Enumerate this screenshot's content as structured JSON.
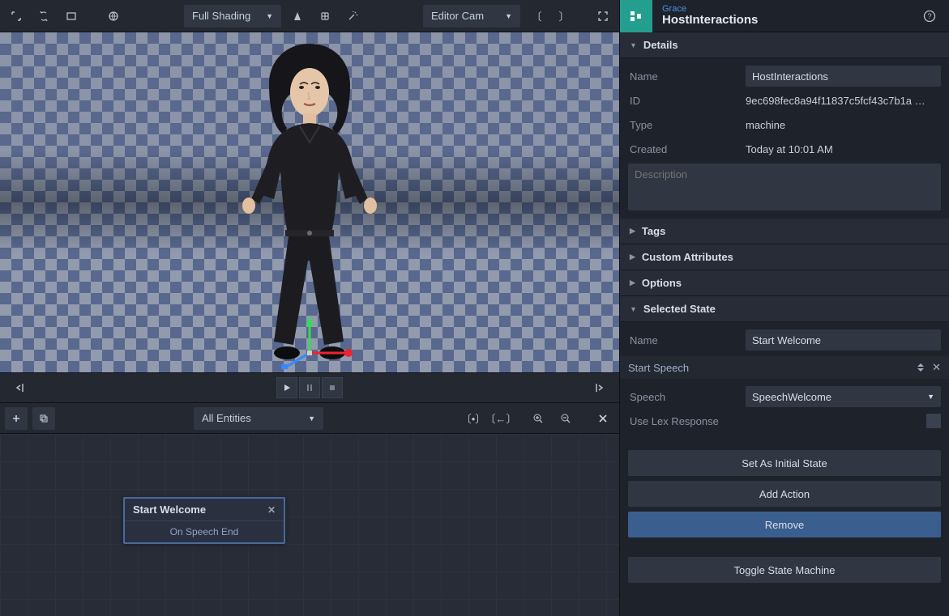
{
  "toolbar": {
    "shading_mode": "Full Shading",
    "camera": "Editor Cam"
  },
  "entity_filter": "All Entities",
  "node": {
    "title": "Start Welcome",
    "transition": "On Speech End"
  },
  "inspector": {
    "parent_name": "Grace",
    "title": "HostInteractions",
    "sections": {
      "details": "Details",
      "tags": "Tags",
      "custom_attributes": "Custom Attributes",
      "options": "Options",
      "selected_state": "Selected State"
    },
    "details": {
      "name_label": "Name",
      "name_value": "HostInteractions",
      "id_label": "ID",
      "id_value": "9ec698fec8a94f11837c5fcf43c7b1a …",
      "type_label": "Type",
      "type_value": "machine",
      "created_label": "Created",
      "created_value": "Today at 10:01 AM",
      "description_label": "Description",
      "description_value": ""
    },
    "state": {
      "name_label": "Name",
      "name_value": "Start Welcome",
      "action_header": "Start Speech",
      "speech_label": "Speech",
      "speech_value": "SpeechWelcome",
      "lex_label": "Use Lex Response"
    },
    "buttons": {
      "set_initial": "Set As Initial State",
      "add_action": "Add Action",
      "remove": "Remove",
      "toggle": "Toggle State Machine"
    }
  }
}
